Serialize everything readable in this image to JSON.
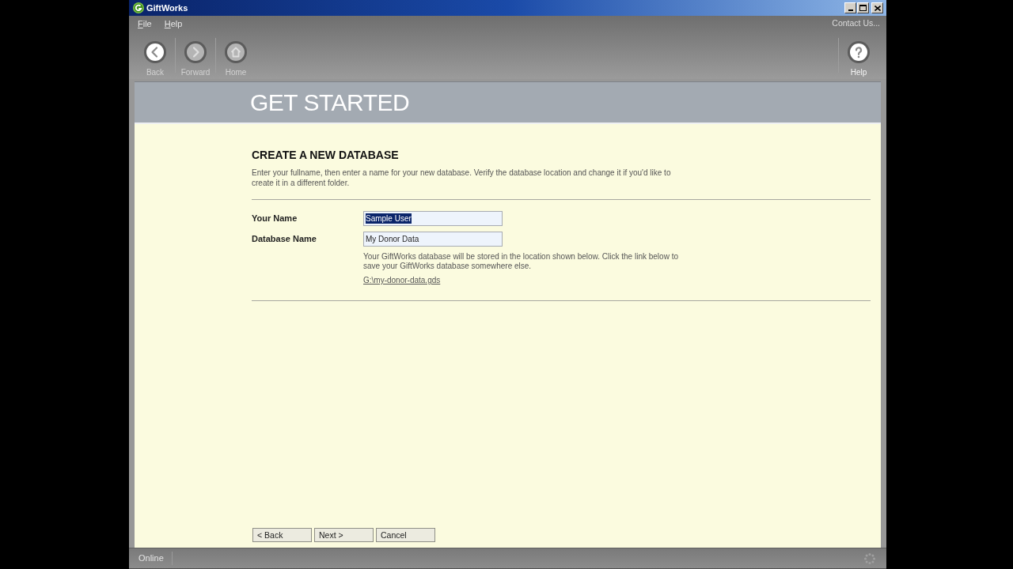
{
  "window": {
    "title": "GiftWorks"
  },
  "menu": [
    {
      "label": "File"
    },
    {
      "label": "Help"
    }
  ],
  "contact_link": "Contact Us...",
  "toolbar": {
    "left": [
      {
        "kind": "back",
        "label": "Back",
        "disabled": false
      },
      {
        "kind": "forward",
        "label": "Forward",
        "disabled": true
      },
      {
        "kind": "home",
        "label": "Home",
        "disabled": true
      }
    ],
    "right": [
      {
        "kind": "help",
        "label": "Help",
        "disabled": false
      }
    ]
  },
  "header": {
    "title": "GET STARTED"
  },
  "section": {
    "title": "CREATE A NEW DATABASE",
    "description": "Enter your fullname, then enter a name for your new database. Verify the database location and change it if you'd like to create it in a different folder.",
    "fields": [
      {
        "label": "Your Name",
        "value": "Sample User",
        "text_selected": true
      },
      {
        "label": "Database Name",
        "value": "My Donor Data",
        "text_selected": false
      }
    ],
    "location_note": "Your GiftWorks database will be stored in the location shown below. Click the link below to save your GiftWorks database somewhere else.",
    "location_link": "G:\\my-donor-data.gds"
  },
  "buttons": [
    {
      "label": "< Back"
    },
    {
      "label": "Next >"
    },
    {
      "label": "Cancel"
    }
  ],
  "status_bar": {
    "status": "Online"
  }
}
